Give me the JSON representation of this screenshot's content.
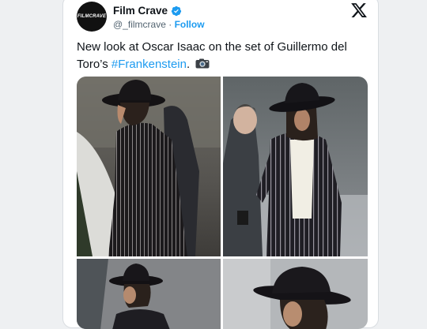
{
  "account": {
    "avatar_text": "FILMCRAVE",
    "display_name": "Film Crave",
    "handle": "@_filmcrave",
    "separator": "·",
    "follow_label": "Follow"
  },
  "tweet": {
    "text_before": "New look at Oscar Isaac on the set of Guillermo del Toro’s ",
    "hashtag": "#Frankenstein",
    "text_after": "."
  },
  "icons": {
    "verified": "verified-badge-icon",
    "platform": "x-logo-icon",
    "camera": "camera-emoji-icon"
  },
  "colors": {
    "accent": "#1d9bf0",
    "text": "#0f1419",
    "muted": "#536471"
  }
}
